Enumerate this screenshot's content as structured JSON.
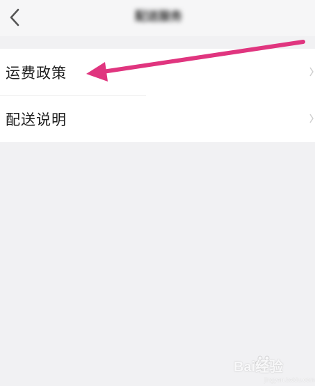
{
  "nav": {
    "title": "配送服务"
  },
  "menu": {
    "items": [
      {
        "label": "运费政策"
      },
      {
        "label": "配送说明"
      }
    ]
  },
  "annotation": {
    "arrow_color": "#e0357f"
  },
  "watermark": {
    "text": "Bai经验",
    "subtext": "jingyan.baidu.com"
  }
}
